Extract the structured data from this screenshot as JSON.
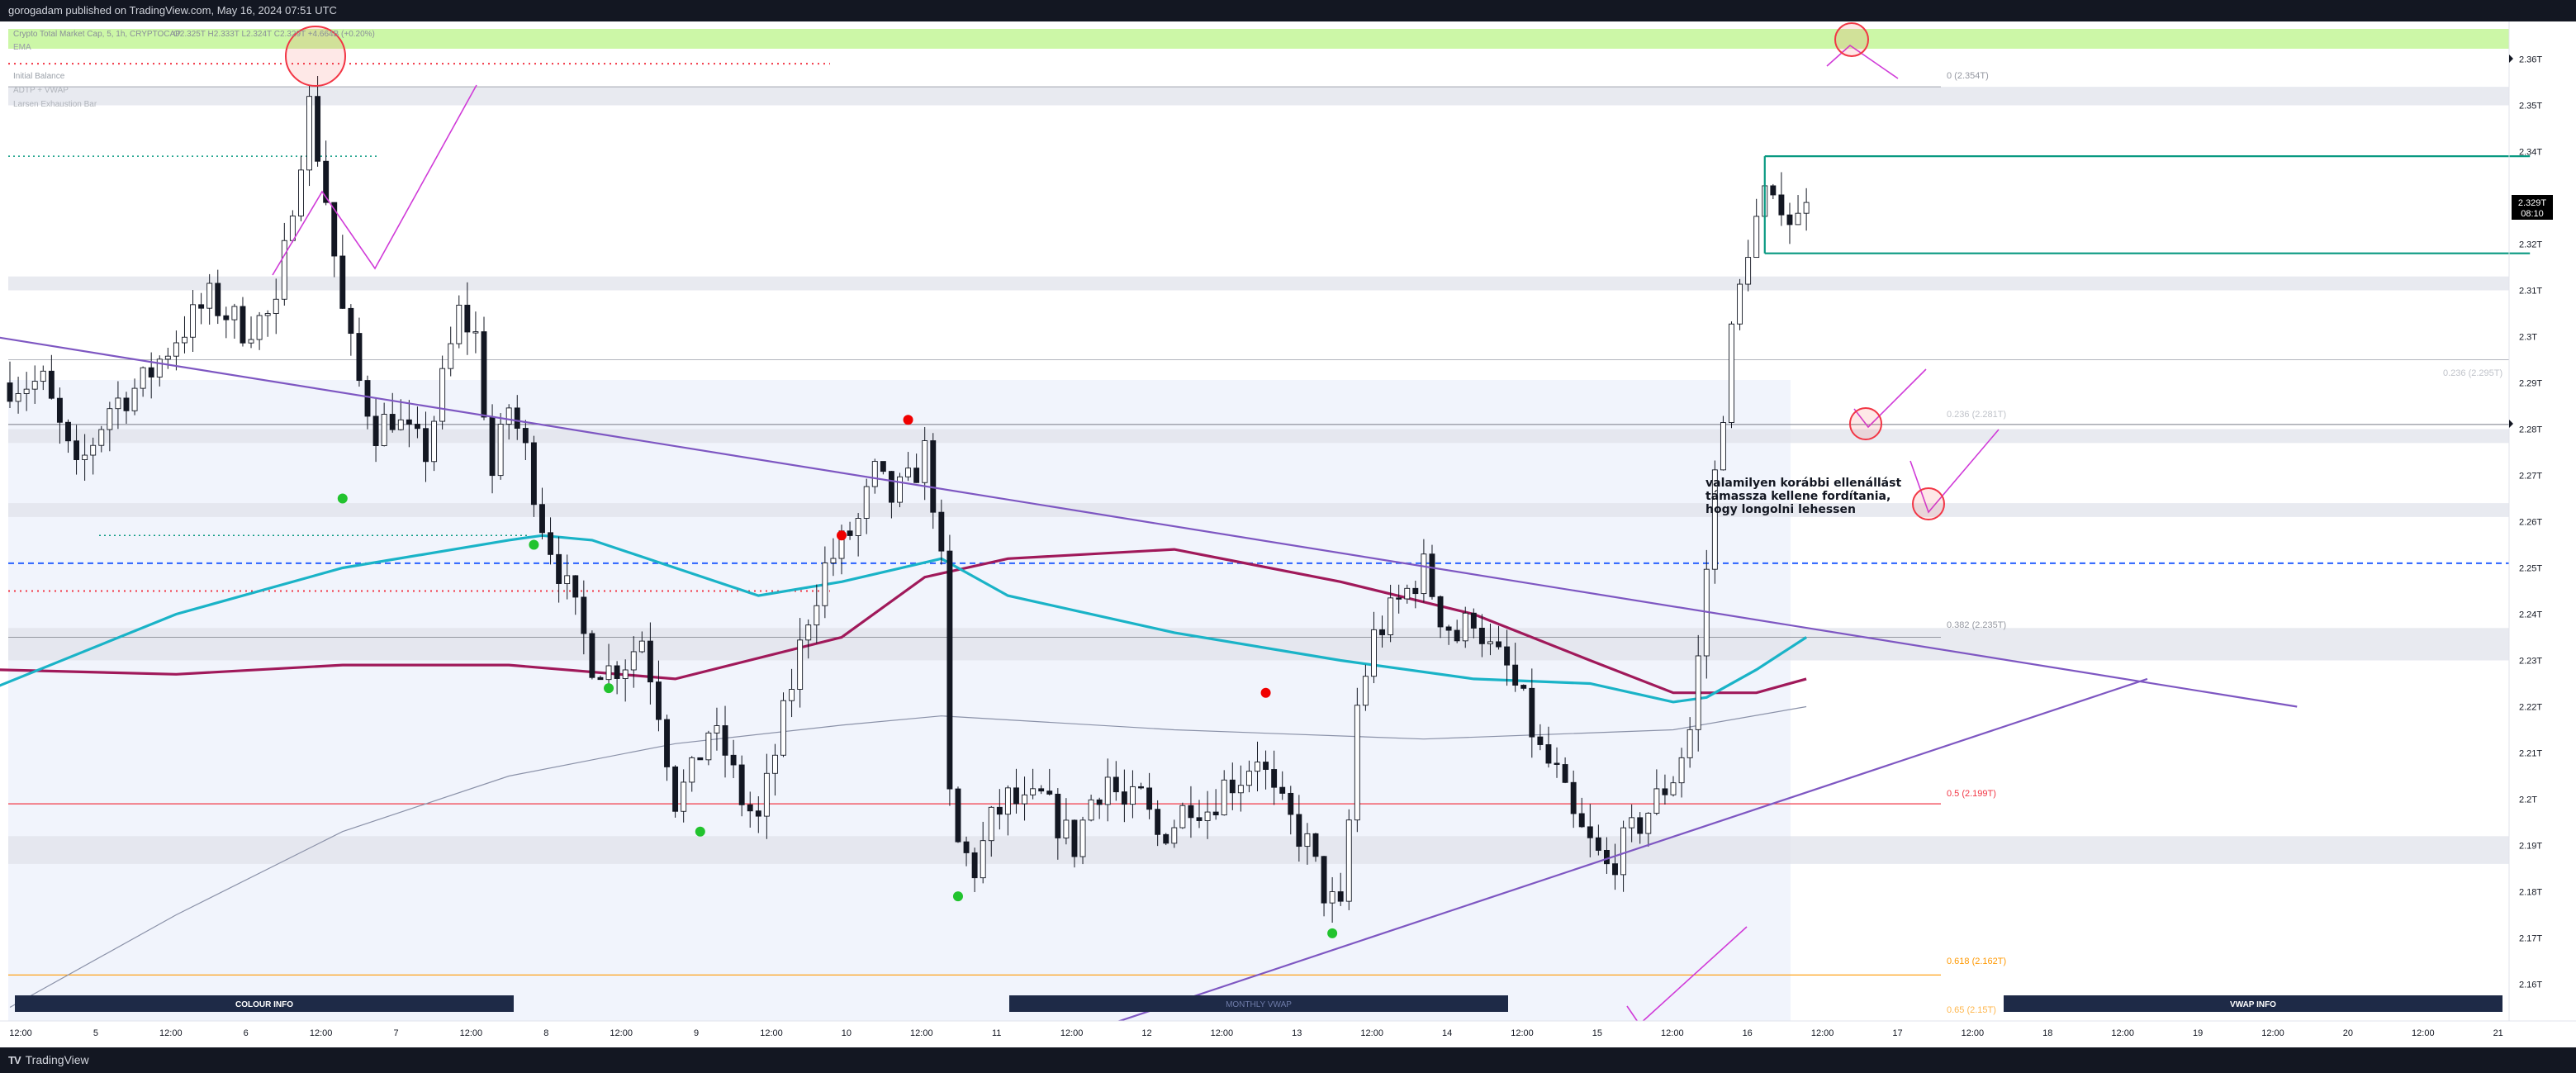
{
  "header": {
    "published": "gorogadam published on TradingView.com, May 16, 2024 07:51 UTC"
  },
  "legend": {
    "symbol_line": "Crypto Total Market Cap, 5, 1h, CRYPTOCAP",
    "ohlc": "O2.325T H2.333T L2.324T C2.329T +4.664B (+0.20%)",
    "indicators": [
      "EMA",
      "Initial Balance",
      "ADTP + VWAP",
      "Larsen Exhaustion Bar"
    ]
  },
  "footer": {
    "brand": "TradingView",
    "brand_icon": "tv-logo-icon"
  },
  "price_tag": {
    "price": "2.329T",
    "countdown": "08:10"
  },
  "annotation": {
    "lines": [
      "valamilyen korábbi ellenállást",
      "támassza kellene fordítania,",
      "hogy longolni lehessen"
    ]
  },
  "fib_labels": [
    {
      "text": "0 (2.354T)",
      "color": "#9598a1"
    },
    {
      "text": "0.236 (2.295T)",
      "color": "#b2b5be"
    },
    {
      "text": "0.236 (2.281T)",
      "color": "#b2b5be"
    },
    {
      "text": "0.382 (2.235T)",
      "color": "#9598a1"
    },
    {
      "text": "0.5 (2.199T)",
      "color": "#f23645"
    },
    {
      "text": "0.618 (2.162T)",
      "color": "#ff9800"
    },
    {
      "text": "0.65 (2.15T)",
      "color": "#ff9800"
    }
  ],
  "panels": [
    "COLOUR INFO",
    "MONTHLY VWAP",
    "VWAP INFO"
  ],
  "chart_data": {
    "type": "candlestick",
    "title": "Crypto Total Market Cap, 5, 1h, CRYPTOCAP",
    "ylabel": "",
    "ylim": [
      2.15,
      2.365
    ],
    "y_ticks": [
      "2.36T",
      "2.35T",
      "2.34T",
      "2.33T",
      "2.32T",
      "2.31T",
      "2.3T",
      "2.29T",
      "2.28T",
      "2.27T",
      "2.26T",
      "2.25T",
      "2.24T",
      "2.23T",
      "2.22T",
      "2.21T",
      "2.2T",
      "2.19T",
      "2.18T",
      "2.17T",
      "2.16T"
    ],
    "x_ticks": [
      "12:00",
      "5",
      "12:00",
      "6",
      "12:00",
      "7",
      "12:00",
      "8",
      "12:00",
      "9",
      "12:00",
      "10",
      "12:00",
      "11",
      "12:00",
      "12",
      "12:00",
      "13",
      "12:00",
      "14",
      "12:00",
      "15",
      "12:00",
      "16",
      "12:00",
      "17",
      "12:00",
      "18",
      "12:00",
      "19",
      "12:00",
      "20",
      "12:00",
      "21"
    ],
    "close_path": [
      [
        0,
        2.29
      ],
      [
        4,
        2.29
      ],
      [
        8,
        2.27
      ],
      [
        12,
        2.285
      ],
      [
        16,
        2.29
      ],
      [
        20,
        2.3
      ],
      [
        24,
        2.308
      ],
      [
        28,
        2.302
      ],
      [
        32,
        2.305
      ],
      [
        34,
        2.33
      ],
      [
        36,
        2.35
      ],
      [
        38,
        2.33
      ],
      [
        40,
        2.305
      ],
      [
        42,
        2.29
      ],
      [
        44,
        2.28
      ],
      [
        46,
        2.283
      ],
      [
        48,
        2.278
      ],
      [
        50,
        2.275
      ],
      [
        54,
        2.305
      ],
      [
        56,
        2.3
      ],
      [
        58,
        2.27
      ],
      [
        60,
        2.285
      ],
      [
        62,
        2.275
      ],
      [
        64,
        2.26
      ],
      [
        66,
        2.25
      ],
      [
        68,
        2.24
      ],
      [
        70,
        2.23
      ],
      [
        72,
        2.228
      ],
      [
        74,
        2.23
      ],
      [
        76,
        2.235
      ],
      [
        78,
        2.22
      ],
      [
        80,
        2.2
      ],
      [
        82,
        2.205
      ],
      [
        84,
        2.215
      ],
      [
        86,
        2.21
      ],
      [
        88,
        2.2
      ],
      [
        90,
        2.195
      ],
      [
        92,
        2.21
      ],
      [
        94,
        2.225
      ],
      [
        96,
        2.24
      ],
      [
        98,
        2.25
      ],
      [
        100,
        2.255
      ],
      [
        102,
        2.26
      ],
      [
        104,
        2.27
      ],
      [
        106,
        2.265
      ],
      [
        108,
        2.268
      ],
      [
        110,
        2.275
      ],
      [
        111,
        2.265
      ],
      [
        112,
        2.25
      ],
      [
        113,
        2.2
      ],
      [
        114,
        2.19
      ],
      [
        116,
        2.185
      ],
      [
        118,
        2.195
      ],
      [
        120,
        2.2
      ],
      [
        122,
        2.198
      ],
      [
        124,
        2.2
      ],
      [
        126,
        2.195
      ],
      [
        128,
        2.19
      ],
      [
        130,
        2.2
      ],
      [
        132,
        2.205
      ],
      [
        134,
        2.198
      ],
      [
        136,
        2.2
      ],
      [
        138,
        2.192
      ],
      [
        140,
        2.195
      ],
      [
        142,
        2.2
      ],
      [
        144,
        2.198
      ],
      [
        146,
        2.203
      ],
      [
        148,
        2.205
      ],
      [
        150,
        2.21
      ],
      [
        152,
        2.2
      ],
      [
        154,
        2.195
      ],
      [
        156,
        2.19
      ],
      [
        158,
        2.18
      ],
      [
        160,
        2.175
      ],
      [
        161,
        2.195
      ],
      [
        162,
        2.22
      ],
      [
        164,
        2.235
      ],
      [
        166,
        2.24
      ],
      [
        168,
        2.245
      ],
      [
        170,
        2.25
      ],
      [
        172,
        2.24
      ],
      [
        174,
        2.235
      ],
      [
        176,
        2.24
      ],
      [
        178,
        2.232
      ],
      [
        180,
        2.228
      ],
      [
        182,
        2.22
      ],
      [
        184,
        2.21
      ],
      [
        186,
        2.205
      ],
      [
        188,
        2.195
      ],
      [
        190,
        2.19
      ],
      [
        192,
        2.185
      ],
      [
        194,
        2.19
      ],
      [
        196,
        2.195
      ],
      [
        198,
        2.2
      ],
      [
        200,
        2.205
      ],
      [
        202,
        2.215
      ],
      [
        203,
        2.23
      ],
      [
        204,
        2.25
      ],
      [
        205,
        2.27
      ],
      [
        206,
        2.285
      ],
      [
        207,
        2.3
      ],
      [
        208,
        2.31
      ],
      [
        209,
        2.32
      ],
      [
        210,
        2.325
      ],
      [
        211,
        2.33
      ],
      [
        212,
        2.327
      ],
      [
        213,
        2.33
      ],
      [
        214,
        2.326
      ],
      [
        215,
        2.325
      ],
      [
        216,
        2.329
      ]
    ],
    "lines": {
      "ema_fast_cyan": [
        [
          -2,
          2.224
        ],
        [
          20,
          2.24
        ],
        [
          40,
          2.25
        ],
        [
          60,
          2.256
        ],
        [
          64,
          2.257
        ],
        [
          70,
          2.256
        ],
        [
          80,
          2.25
        ],
        [
          90,
          2.244
        ],
        [
          100,
          2.247
        ],
        [
          112,
          2.252
        ],
        [
          120,
          2.244
        ],
        [
          140,
          2.236
        ],
        [
          160,
          2.23
        ],
        [
          176,
          2.226
        ],
        [
          190,
          2.225
        ],
        [
          200,
          2.221
        ],
        [
          204,
          2.222
        ],
        [
          210,
          2.228
        ],
        [
          216,
          2.235
        ]
      ],
      "ema_slow_maroon": [
        [
          -2,
          2.228
        ],
        [
          20,
          2.227
        ],
        [
          40,
          2.229
        ],
        [
          60,
          2.229
        ],
        [
          80,
          2.226
        ],
        [
          100,
          2.235
        ],
        [
          110,
          2.248
        ],
        [
          120,
          2.252
        ],
        [
          140,
          2.254
        ],
        [
          160,
          2.247
        ],
        [
          176,
          2.24
        ],
        [
          190,
          2.23
        ],
        [
          200,
          2.223
        ],
        [
          210,
          2.223
        ],
        [
          216,
          2.226
        ]
      ],
      "ema_long_grey": [
        [
          0,
          2.155
        ],
        [
          20,
          2.175
        ],
        [
          40,
          2.193
        ],
        [
          60,
          2.205
        ],
        [
          80,
          2.212
        ],
        [
          100,
          2.216
        ],
        [
          112,
          2.218
        ],
        [
          140,
          2.215
        ],
        [
          170,
          2.213
        ],
        [
          200,
          2.215
        ],
        [
          216,
          2.22
        ]
      ],
      "descending_trend": [
        [
          -2,
          2.3
        ],
        [
          275,
          2.22
        ]
      ],
      "ascending_trend": [
        [
          130,
          2.15
        ],
        [
          257,
          2.226
        ]
      ],
      "resistance_green_top": [
        [
          211,
          2.339
        ],
        [
          303,
          2.339
        ]
      ],
      "support_green": [
        [
          211,
          2.318
        ],
        [
          303,
          2.318
        ]
      ]
    },
    "horizontal_levels": [
      {
        "value": 2.354,
        "label": "0 (2.354T)"
      },
      {
        "value": 2.295,
        "label": "0.236 (2.295T)"
      },
      {
        "value": 2.281,
        "label": "0.236 (2.281T)"
      },
      {
        "value": 2.235,
        "label": "0.382 (2.235T)"
      },
      {
        "value": 2.199,
        "label": "0.5 (2.199T)"
      },
      {
        "value": 2.162,
        "label": "0.618 (2.162T)"
      },
      {
        "value": 2.15,
        "label": "0.65 (2.15T)"
      },
      {
        "value": 2.251,
        "label": "dashed-blue"
      }
    ],
    "grey_zones": [
      [
        2.354,
        2.35
      ],
      [
        2.313,
        2.31
      ],
      [
        2.28,
        2.277
      ],
      [
        2.264,
        2.261
      ],
      [
        2.237,
        2.23
      ],
      [
        2.192,
        2.186
      ],
      [
        2.151,
        2.149
      ]
    ],
    "markers": [
      {
        "type": "green-dot",
        "x": 40,
        "y": 2.265
      },
      {
        "type": "green-dot",
        "x": 63,
        "y": 2.255
      },
      {
        "type": "green-dot",
        "x": 72,
        "y": 2.224
      },
      {
        "type": "green-dot",
        "x": 83,
        "y": 2.193
      },
      {
        "type": "green-dot",
        "x": 114,
        "y": 2.179
      },
      {
        "type": "green-dot",
        "x": 159,
        "y": 2.171
      },
      {
        "type": "red-dot",
        "x": 100,
        "y": 2.257
      },
      {
        "type": "red-dot",
        "x": 108,
        "y": 2.282
      },
      {
        "type": "red-dot",
        "x": 151,
        "y": 2.223
      }
    ],
    "grid": false,
    "legend_position": "top-left"
  }
}
